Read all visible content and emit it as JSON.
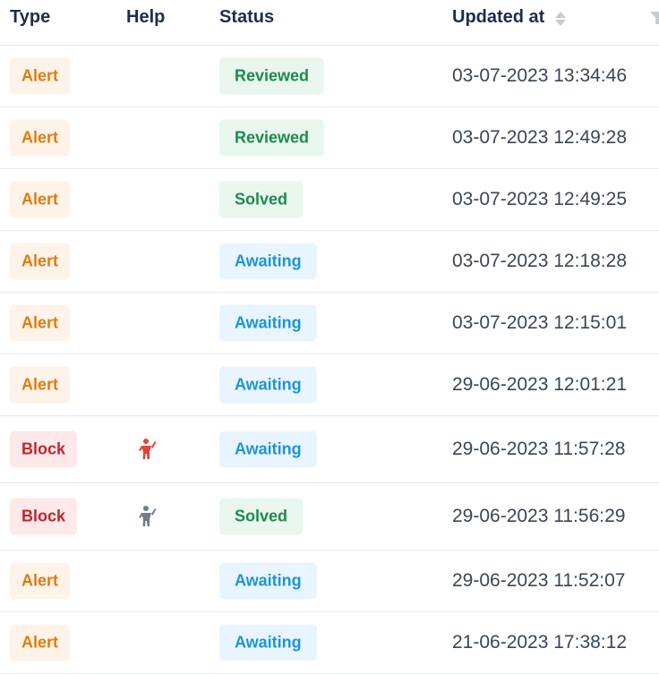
{
  "header": {
    "type": "Type",
    "help": "Help",
    "status": "Status",
    "updated_at": "Updated at"
  },
  "colors": {
    "alert_text": "#e07b10",
    "alert_bg": "#fef3e8",
    "block_text": "#c0262e",
    "block_bg": "#fde8ea",
    "success_text": "#1f8a4c",
    "success_bg": "#e9f6ee",
    "awaiting_text": "#1e94d4",
    "awaiting_bg": "#e8f5fe"
  },
  "rows": [
    {
      "type": "Alert",
      "help": "",
      "status": "Reviewed",
      "updated": "03-07-2023 13:34:46"
    },
    {
      "type": "Alert",
      "help": "",
      "status": "Reviewed",
      "updated": "03-07-2023 12:49:28"
    },
    {
      "type": "Alert",
      "help": "",
      "status": "Solved",
      "updated": "03-07-2023 12:49:25"
    },
    {
      "type": "Alert",
      "help": "",
      "status": "Awaiting",
      "updated": "03-07-2023 12:18:28"
    },
    {
      "type": "Alert",
      "help": "",
      "status": "Awaiting",
      "updated": "03-07-2023 12:15:01"
    },
    {
      "type": "Alert",
      "help": "",
      "status": "Awaiting",
      "updated": "29-06-2023 12:01:21"
    },
    {
      "type": "Block",
      "help": "person-help-icon-red",
      "status": "Awaiting",
      "updated": "29-06-2023 11:57:28"
    },
    {
      "type": "Block",
      "help": "person-help-icon-gray",
      "status": "Solved",
      "updated": "29-06-2023 11:56:29"
    },
    {
      "type": "Alert",
      "help": "",
      "status": "Awaiting",
      "updated": "29-06-2023 11:52:07"
    },
    {
      "type": "Alert",
      "help": "",
      "status": "Awaiting",
      "updated": "21-06-2023 17:38:12"
    }
  ]
}
